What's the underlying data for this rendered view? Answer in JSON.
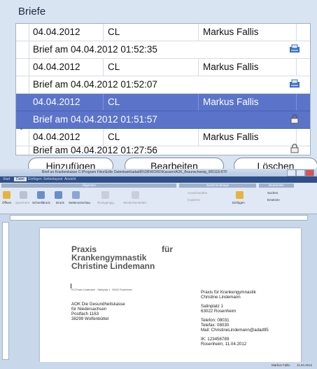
{
  "panel": {
    "title": "Briefe",
    "rows": [
      {
        "date": "04.04.2012",
        "code": "CL",
        "name": "Markus Fallis",
        "subject": "Brief am 04.04.2012 01:52:35"
      },
      {
        "date": "04.04.2012",
        "code": "CL",
        "name": "Markus Fallis",
        "subject": "Brief am 04.04.2012 01:52:07"
      },
      {
        "date": "04.04.2012",
        "code": "CL",
        "name": "Markus Fallis",
        "subject": "Brief am 04.04.2012 01:51:57"
      },
      {
        "date": "04.04.2012",
        "code": "CL",
        "name": "Markus Fallis",
        "subject": "Brief am 04.04.2012 01:27:56"
      }
    ],
    "selected_arrow": ">",
    "buttons": {
      "add": "Hinzufügen",
      "edit": "Bearbeiten",
      "delete": "Löschen"
    }
  },
  "word": {
    "window_title": "Brief an Krankenkasse C:\\Program Files\\Edlix Datenbank\\adad95\\DB\\WORD\\Kassen\\AOK_Braunschweig_000118.RTF",
    "tabs": [
      "Start",
      "Datei",
      "Einfügen",
      "Seitenlayout",
      "Ansicht"
    ],
    "ribbon": {
      "group_general": "Allgemein",
      "group_clipboard": "Zwischenablage",
      "group_edit": "Bearbeiten",
      "items": [
        "Öffnen",
        "Speichern",
        "Schnelldruck",
        "Druck",
        "Seitenvorschau",
        "Rückgängig",
        "Wiederherstellen",
        "Ausschneiden",
        "Kopieren",
        "Einfügen",
        "Suchen",
        "Ersetzen"
      ]
    },
    "letter": {
      "heading1": "Praxis",
      "heading1b": "für",
      "heading2": "Krankengymnastik",
      "heading3": "Christine Lindemann",
      "sender_line": "KG-Praxis Lindemann · Salinplatz 1 · 83022 Rosenheim",
      "recipient": [
        "AOK Die Gesundheitskasse",
        "für Niedersachsen",
        "Postfach 1163",
        "38299 Wolfenbüttel"
      ],
      "sender": [
        "Praxis für Krankengymnastik",
        "Christine Lindemann",
        "",
        "Salinplatz 1",
        "63022 Rosenheim",
        "",
        "Telefon: 08031",
        "Telefax: 08030",
        "Mail: ChristineLindemann@adad95",
        "",
        "IK: 123456789",
        "Rosenheim, 11.04.2012"
      ]
    },
    "status": {
      "user": "Markus Fallis",
      "date": "11.04.2012"
    }
  }
}
